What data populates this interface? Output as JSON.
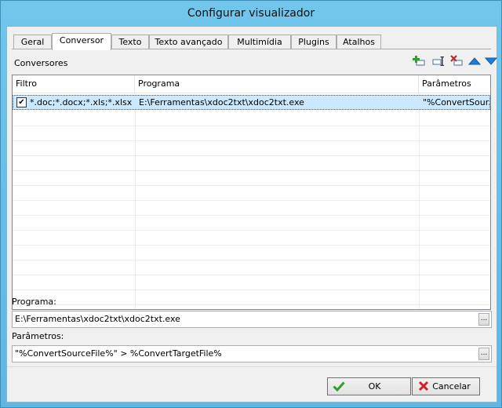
{
  "window": {
    "title": "Configurar visualizador"
  },
  "tabs": [
    "Geral",
    "Conversor",
    "Texto",
    "Texto avançado",
    "Multimídia",
    "Plugins",
    "Atalhos"
  ],
  "active_tab": "Conversor",
  "section": {
    "title": "Conversores"
  },
  "toolbar": {
    "icons": [
      "add-icon",
      "edit-icon",
      "delete-icon",
      "move-up-icon",
      "move-down-icon"
    ],
    "colors": {
      "add": "#2e9e2e",
      "delete": "#d42020",
      "arrow": "#1e7fd8"
    }
  },
  "list": {
    "columns": [
      "Filtro",
      "Programa",
      "Parâmetros"
    ],
    "rows": [
      {
        "checked": true,
        "filter": "*.doc;*.docx;*.xls;*.xlsx",
        "program": "E:\\Ferramentas\\xdoc2txt\\xdoc2txt.exe",
        "params": "\"%ConvertSour..."
      }
    ]
  },
  "program": {
    "label": "Programa:",
    "value": "E:\\Ferramentas\\xdoc2txt\\xdoc2txt.exe",
    "browse": "..."
  },
  "params": {
    "label": "Parâmetros:",
    "value": "\"%ConvertSourceFile%\" > %ConvertTargetFile%",
    "browse": "..."
  },
  "buttons": {
    "ok": "OK",
    "cancel": "Cancelar"
  }
}
